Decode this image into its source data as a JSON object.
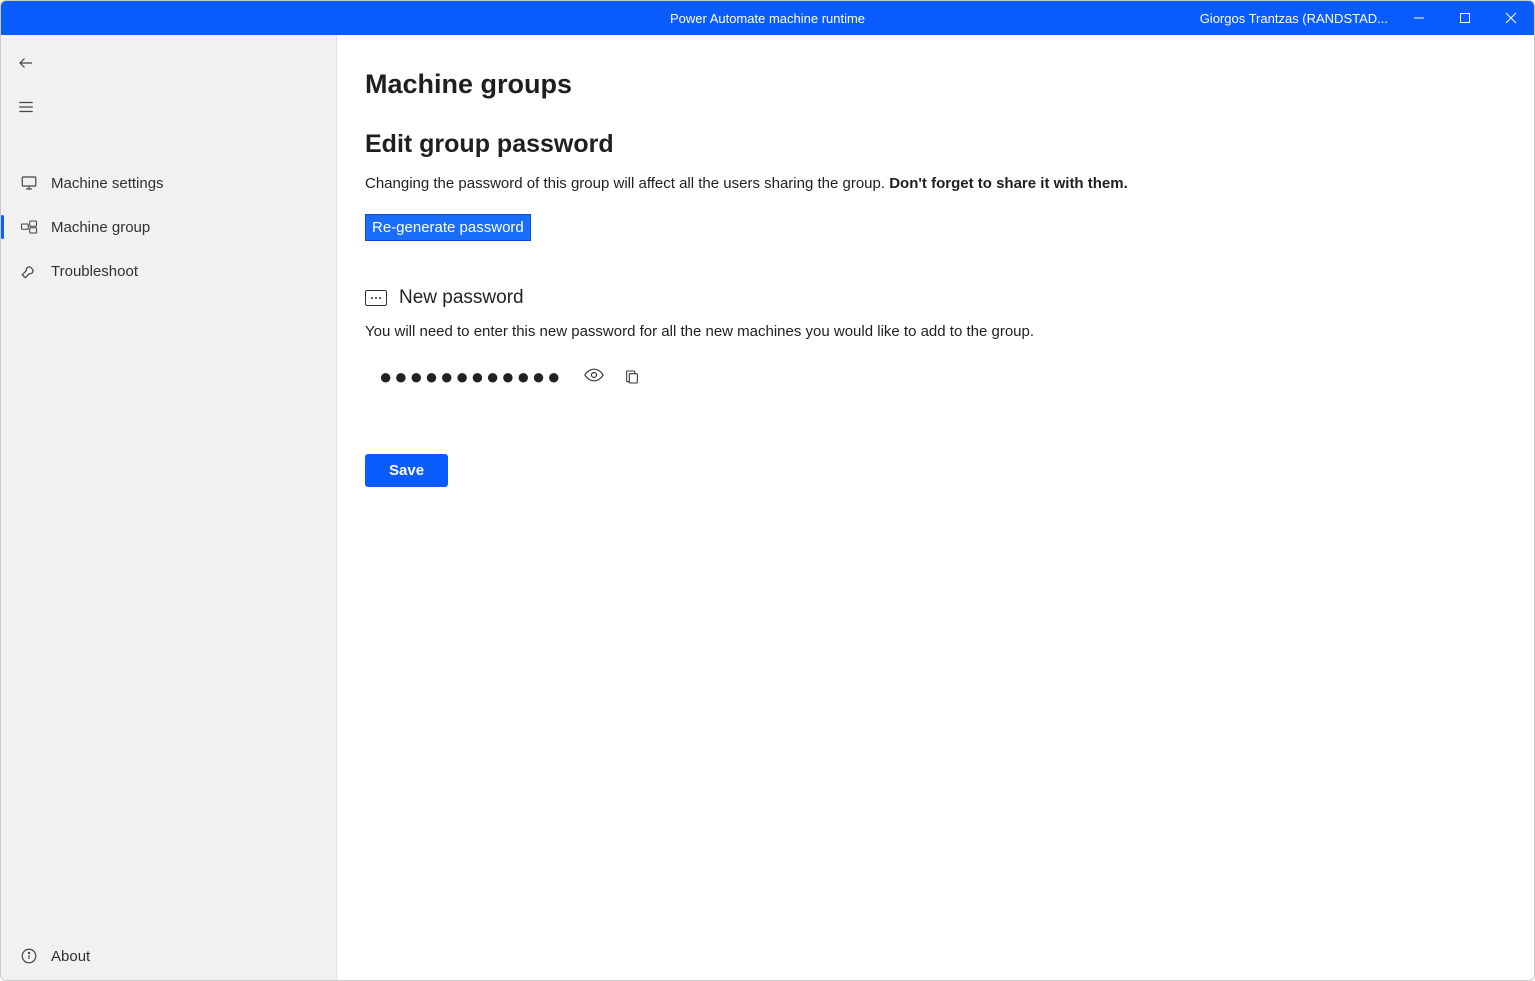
{
  "titlebar": {
    "title": "Power Automate machine runtime",
    "user": "Giorgos Trantzas (RANDSTAD..."
  },
  "sidebar": {
    "items": [
      {
        "label": "Machine settings"
      },
      {
        "label": "Machine group"
      },
      {
        "label": "Troubleshoot"
      }
    ],
    "about": "About"
  },
  "main": {
    "heading": "Machine groups",
    "subheading": "Edit group password",
    "desc_prefix": "Changing the password of this group will affect all the users sharing the group. ",
    "desc_strong": "Don't forget to share it with them.",
    "regenerate": "Re-generate password",
    "new_password_label": "New password",
    "desc2": "You will need to enter this new password for all the new machines you would like to add to the group.",
    "password_masked": "●●●●●●●●●●●●",
    "save": "Save"
  }
}
